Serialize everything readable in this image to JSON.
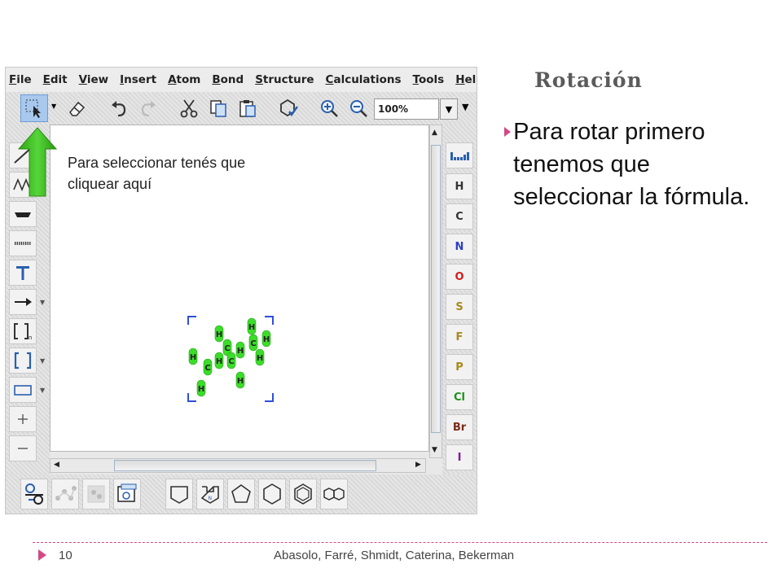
{
  "app": {
    "menu": [
      {
        "label": "File"
      },
      {
        "label": "Edit"
      },
      {
        "label": "View"
      },
      {
        "label": "Insert"
      },
      {
        "label": "Atom"
      },
      {
        "label": "Bond"
      },
      {
        "label": "Structure"
      },
      {
        "label": "Calculations"
      },
      {
        "label": "Tools"
      },
      {
        "label": "Help"
      }
    ],
    "zoom_value": "100%",
    "toolbar_icons": [
      "select-icon",
      "eraser-icon",
      "undo-icon",
      "redo-icon",
      "cut-icon",
      "copy-icon",
      "paste-icon",
      "clean-structure-icon",
      "zoom-in-icon",
      "zoom-out-icon"
    ],
    "left_tools": [
      "single-bond-icon",
      "chain-icon",
      "bond-style-icon",
      "dashed-bond-icon",
      "text-tool-icon",
      "arrow-tool-icon",
      "sgroup-bracket-icon",
      "bracket-icon",
      "rectangle-icon",
      "plus-icon",
      "minus-icon"
    ],
    "atom_buttons": [
      {
        "label": "H",
        "color": "#333333"
      },
      {
        "label": "C",
        "color": "#333333"
      },
      {
        "label": "N",
        "color": "#2b3fc4"
      },
      {
        "label": "O",
        "color": "#d01c1c"
      },
      {
        "label": "S",
        "color": "#a8891a"
      },
      {
        "label": "F",
        "color": "#a8891a"
      },
      {
        "label": "P",
        "color": "#a8891a"
      },
      {
        "label": "Cl",
        "color": "#1e8f1e"
      },
      {
        "label": "Br",
        "color": "#7a2b16"
      },
      {
        "label": "I",
        "color": "#7e1aa0"
      }
    ],
    "bottom_templates": [
      "template-library-icon",
      "template-chain-icon",
      "template-ring-icon",
      "template-custom-icon",
      "cyclopentane-chair-icon",
      "pyrrole-icon",
      "cyclopentane-icon",
      "cyclohexane-icon",
      "benzene-icon",
      "naphthalene-icon"
    ],
    "molecule_atoms": [
      "H",
      "H",
      "H",
      "H",
      "C",
      "C",
      "H",
      "H",
      "H",
      "C",
      "C",
      "H",
      "H",
      "H"
    ],
    "callout_text": "Para seleccionar tenés que cliquear aquí",
    "accent_green": "#3bbf1c",
    "selection_color": "#2f4fd8"
  },
  "slide": {
    "title": "Rotación",
    "bullet": "Para rotar primero tenemos que seleccionar la fórmula."
  },
  "footer": {
    "page_number": "10",
    "authors": "Abasolo, Farré, Shmidt, Caterina, Bekerman",
    "accent": "#d04a86"
  }
}
